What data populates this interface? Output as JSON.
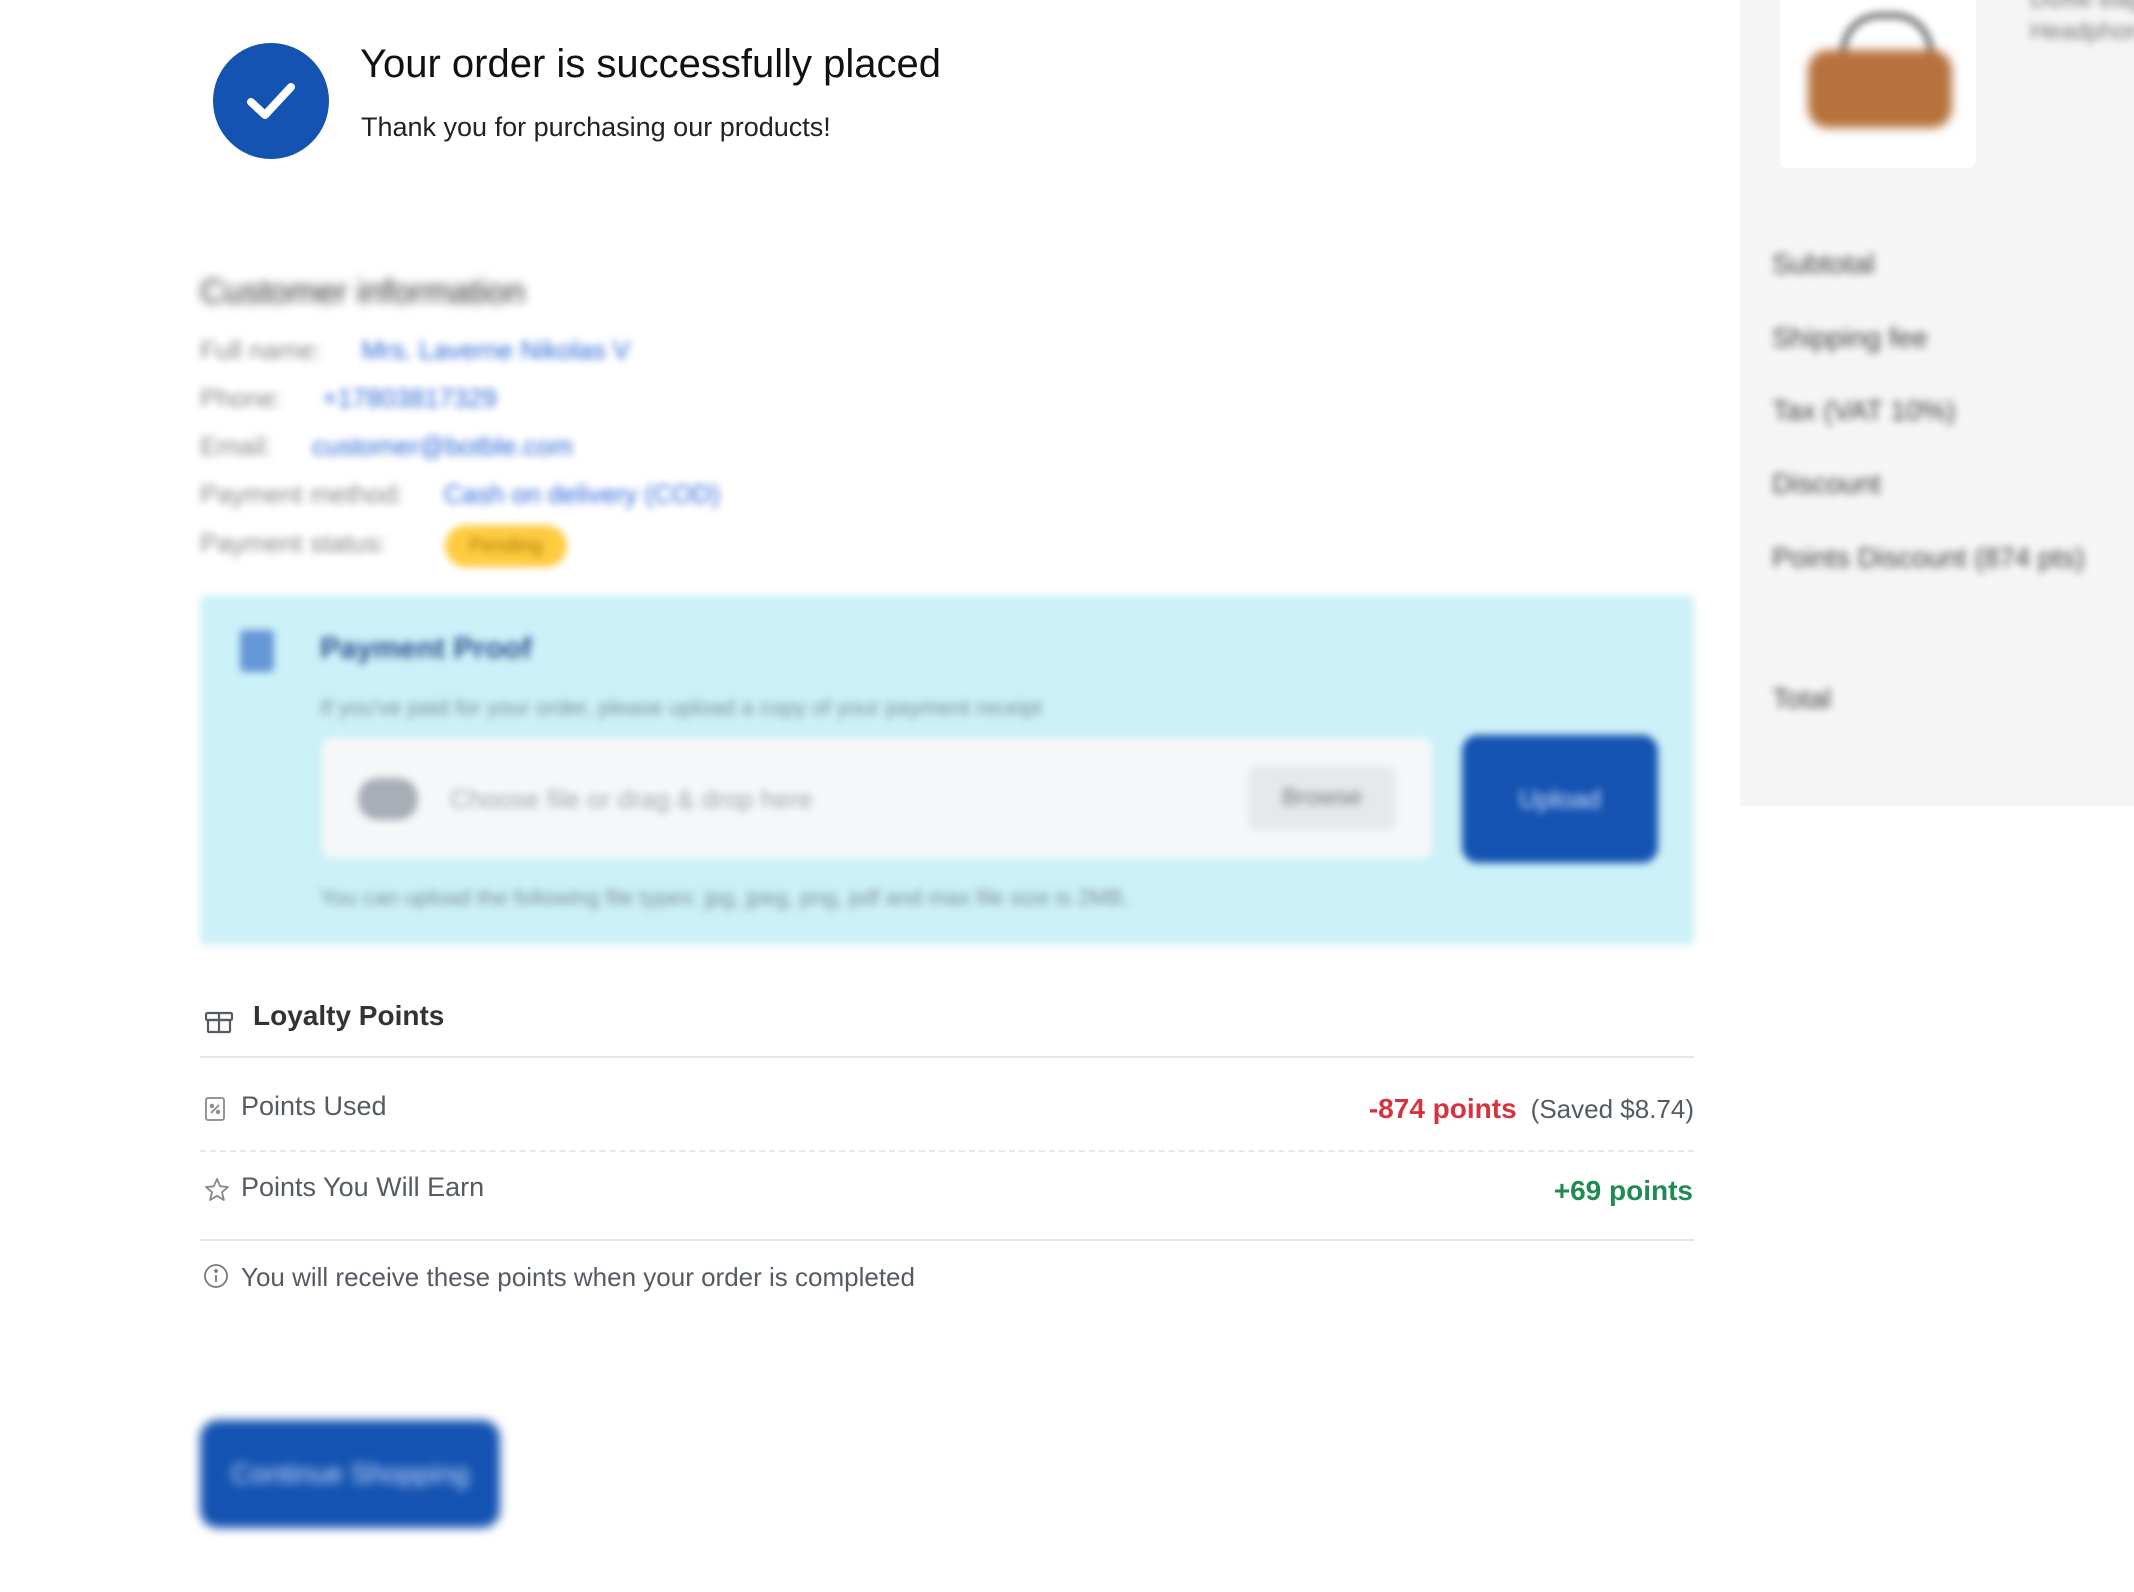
{
  "header": {
    "title": "Your order is successfully placed",
    "subtitle": "Thank you for purchasing our products!",
    "icon": "check-circle-icon",
    "accent_color": "#1453b2"
  },
  "customer_info": {
    "heading": "Customer information",
    "rows": [
      {
        "label": "Full name:",
        "value": "Mrs. Laverne Nikolas V"
      },
      {
        "label": "Phone:",
        "value": "+17803817329"
      },
      {
        "label": "Email:",
        "value": "customer@botble.com"
      },
      {
        "label": "Payment method:",
        "value": "Cash on delivery (COD)"
      },
      {
        "label": "Payment status:",
        "value": "Pending"
      }
    ]
  },
  "payment_proof": {
    "title": "Payment Proof",
    "description": "If you've paid for your order, please upload a copy of your payment receipt",
    "placeholder": "Choose file or drag & drop here",
    "browse_label": "Browse",
    "upload_label": "Upload",
    "note": "You can upload the following file types: jpg, jpeg, png, pdf and max file size is 2MB."
  },
  "loyalty": {
    "title": "Loyalty Points",
    "used_label": "Points Used",
    "used_value": "-874 points",
    "used_saved": "(Saved $8.74)",
    "earn_label": "Points You Will Earn",
    "earn_value": "+69 points",
    "info": "You will receive these points when your order is completed",
    "used_color": "#d63341",
    "earn_color": "#1f8a52"
  },
  "continue_button": "Continue Shopping",
  "summary": {
    "product_name": "Duffle Bag",
    "product_variant": "Headphone",
    "rows": [
      "Subtotal",
      "Shipping fee",
      "Tax (VAT 10%)",
      "Discount",
      "Points Discount (874 pts)",
      "Total"
    ]
  }
}
